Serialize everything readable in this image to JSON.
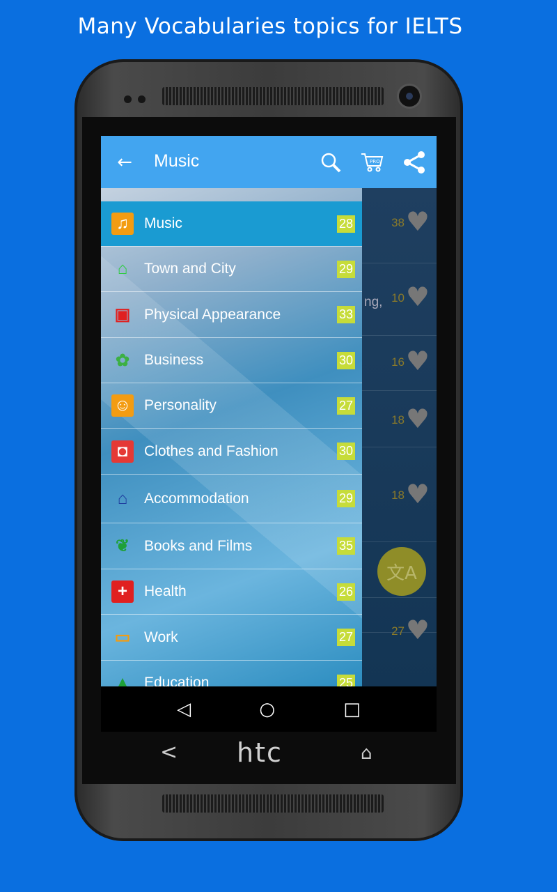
{
  "headline": "Many Vocabularies topics for IELTS",
  "phone": {
    "brand": "htc"
  },
  "toolbar": {
    "title": "Music",
    "icons": [
      "back-arrow",
      "search",
      "cart-pro",
      "share"
    ]
  },
  "drawer": {
    "items": [
      {
        "label": "Music",
        "count": "28",
        "icon": "music-library",
        "color": "#f39c12",
        "active": true
      },
      {
        "label": "Town and City",
        "count": "29",
        "icon": "bank",
        "color": "#2ecc40"
      },
      {
        "label": "Physical Appearance",
        "count": "33",
        "icon": "chip",
        "color": "#e02020"
      },
      {
        "label": "Business",
        "count": "30",
        "icon": "film-reel",
        "color": "#3cb043"
      },
      {
        "label": "Personality",
        "count": "27",
        "icon": "contact",
        "color": "#f39c12"
      },
      {
        "label": "Clothes and Fashion",
        "count": "30",
        "icon": "shopping-bag",
        "color": "#e53935"
      },
      {
        "label": "Accommodation",
        "count": "29",
        "icon": "cabin",
        "color": "#1f3fa0"
      },
      {
        "label": "Books and Films",
        "count": "35",
        "icon": "reader",
        "color": "#1ea038"
      },
      {
        "label": "Health",
        "count": "26",
        "icon": "medical-add",
        "color": "#e02020"
      },
      {
        "label": "Work",
        "count": "27",
        "icon": "monitor",
        "color": "#f39c12"
      },
      {
        "label": "Education",
        "count": "25",
        "icon": "graduation-cap",
        "color": "#1ea038"
      }
    ]
  },
  "main": {
    "snippet": "ng,",
    "rows": [
      {
        "count": "38"
      },
      {
        "count": "10"
      },
      {
        "count": "16"
      },
      {
        "count": "18"
      },
      {
        "count": "18"
      },
      {
        "count": ""
      },
      {
        "count": "27"
      }
    ]
  },
  "fab": {
    "icon": "translate",
    "glyph": "文A"
  },
  "navbar": {
    "back": "◁",
    "home": "○",
    "recent": "□"
  },
  "hardware": {
    "back": "<",
    "home": "⌂"
  }
}
